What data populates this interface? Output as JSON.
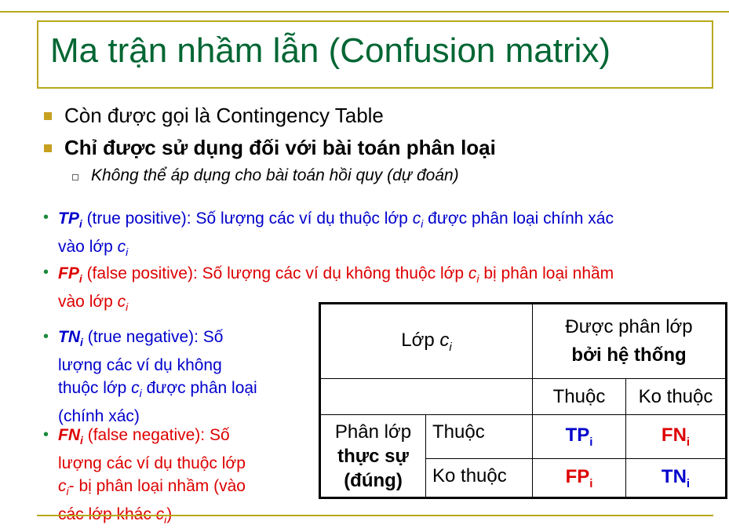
{
  "title": "Ma trận nhầm lẫn (Confusion matrix)",
  "bullets": {
    "b1": "Còn được gọi là Contingency Table",
    "b2": "Chỉ được sử dụng đối với bài toán phân loại",
    "sub": "Không thể áp dụng cho bài toán hồi quy (dự đoán)"
  },
  "defs": {
    "tp": {
      "abbr": "TP",
      "sub": "i",
      "rest1": " (true positive):  Số lượng các ví dụ thuộc lớp ",
      "var": "c",
      "var_sub": "i",
      "rest2": " được phân loại chính xác",
      "line2": "vào lớp ",
      "line2_var": "c",
      "line2_sub": "i"
    },
    "fp": {
      "abbr": "FP",
      "sub": "i",
      "rest1": " (false positive):  Số lượng các ví dụ không thuộc lớp ",
      "var": "c",
      "var_sub": "i",
      "rest2": " bị phân loại nhầm",
      "line2": "vào lớp ",
      "line2_var": "c",
      "line2_sub": "i"
    },
    "tn": {
      "abbr": "TN",
      "sub": "i",
      "l1": " (true negative):  Số",
      "l2": "lượng các ví dụ không",
      "l3a": "thuộc lớp ",
      "l3_var": "c",
      "l3_sub": "i",
      "l3b": " được phân loại",
      "l4": "(chính xác)"
    },
    "fn": {
      "abbr": "FN",
      "sub": "i",
      "l1": " (false negative): Số",
      "l2": "lượng các ví dụ thuộc lớp",
      "l3_var": "c",
      "l3_sub": "i",
      "l3b": "- bị phân loại nhầm (vào",
      "l4a": "các lớp khác ",
      "l4_var": "c",
      "l4_sub": "i",
      "l4b": ")"
    }
  },
  "matrix": {
    "corner": "Lớp ",
    "corner_var": "c",
    "corner_sub": "i",
    "pred_header_1": "Được phân lớp",
    "pred_header_2": "bởi hệ thống",
    "col_belongs": "Thuộc",
    "col_not": "Ko thuộc",
    "actual_1": "Phân lớp",
    "actual_2": "thực sự",
    "actual_3": "(đúng)",
    "row_belongs": "Thuộc",
    "row_not": "Ko thuộc",
    "tp": "TP",
    "fn": "FN",
    "fp": "FP",
    "tn": "TN",
    "idx": "i"
  },
  "colors": {
    "title": "#006633",
    "accent": "#b8a81c",
    "blue": "#0000cc",
    "red": "#dd0000",
    "dot": "#1a8a3a"
  }
}
